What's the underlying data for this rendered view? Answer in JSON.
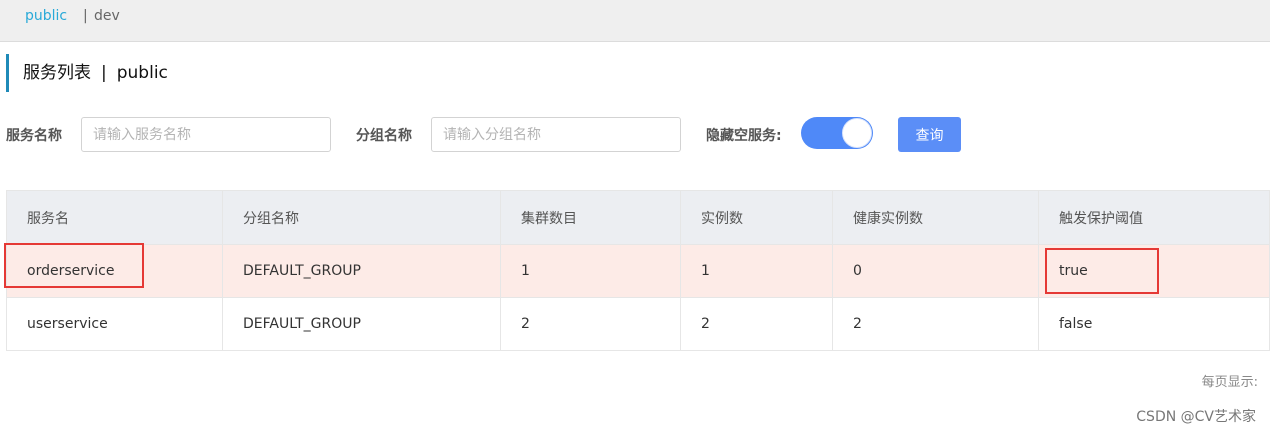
{
  "namespaces": {
    "public": "public",
    "separator": "|",
    "dev": "dev"
  },
  "page_title": {
    "text": "服务列表",
    "separator": "|",
    "namespace": "public"
  },
  "filters": {
    "service_label": "服务名称",
    "service_placeholder": "请输入服务名称",
    "service_value": "",
    "group_label": "分组名称",
    "group_placeholder": "请输入分组名称",
    "group_value": "",
    "hide_empty_label": "隐藏空服务:",
    "hide_empty_on": true,
    "query_button": "查询"
  },
  "table": {
    "headers": [
      "服务名",
      "分组名称",
      "集群数目",
      "实例数",
      "健康实例数",
      "触发保护阈值"
    ],
    "rows": [
      [
        "orderservice",
        "DEFAULT_GROUP",
        "1",
        "1",
        "0",
        "true"
      ],
      [
        "userservice",
        "DEFAULT_GROUP",
        "2",
        "2",
        "2",
        "false"
      ]
    ]
  },
  "footer": {
    "per_page": "每页显示:"
  },
  "watermark": "CSDN @CV艺术家",
  "colors": {
    "accent": "#29a9d8",
    "switch_on": "#4f89f8",
    "button": "#5b8ef7",
    "row_highlight": "#fdebe7",
    "annotation": "#e53935"
  }
}
